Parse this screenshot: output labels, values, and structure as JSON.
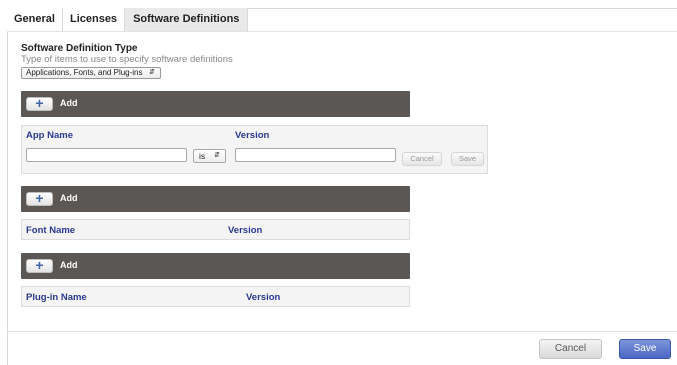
{
  "tabs": [
    {
      "label": "General"
    },
    {
      "label": "Licenses"
    },
    {
      "label": "Software Definitions",
      "active": true
    }
  ],
  "definition_type": {
    "title": "Software Definition Type",
    "subtitle": "Type of items to use to specify software definitions",
    "selected": "Applications, Fonts, and Plug-ins"
  },
  "apps_section": {
    "add_label": "Add",
    "col_name": "App Name",
    "col_version": "Version",
    "name_value": "",
    "operator": "is",
    "version_value": "",
    "cancel_label": "Cancel",
    "save_label": "Save"
  },
  "fonts_section": {
    "add_label": "Add",
    "col_name": "Font Name",
    "col_version": "Version"
  },
  "plugins_section": {
    "add_label": "Add",
    "col_name": "Plug-in Name",
    "col_version": "Version"
  },
  "footer": {
    "cancel_label": "Cancel",
    "save_label": "Save"
  },
  "icons": {
    "add": "plus-icon",
    "select_arrow": "up-down-arrow-icon"
  },
  "colors": {
    "accent": "#4a67c4",
    "add_bar": "#5b5754",
    "column_header": "#2b3990"
  }
}
